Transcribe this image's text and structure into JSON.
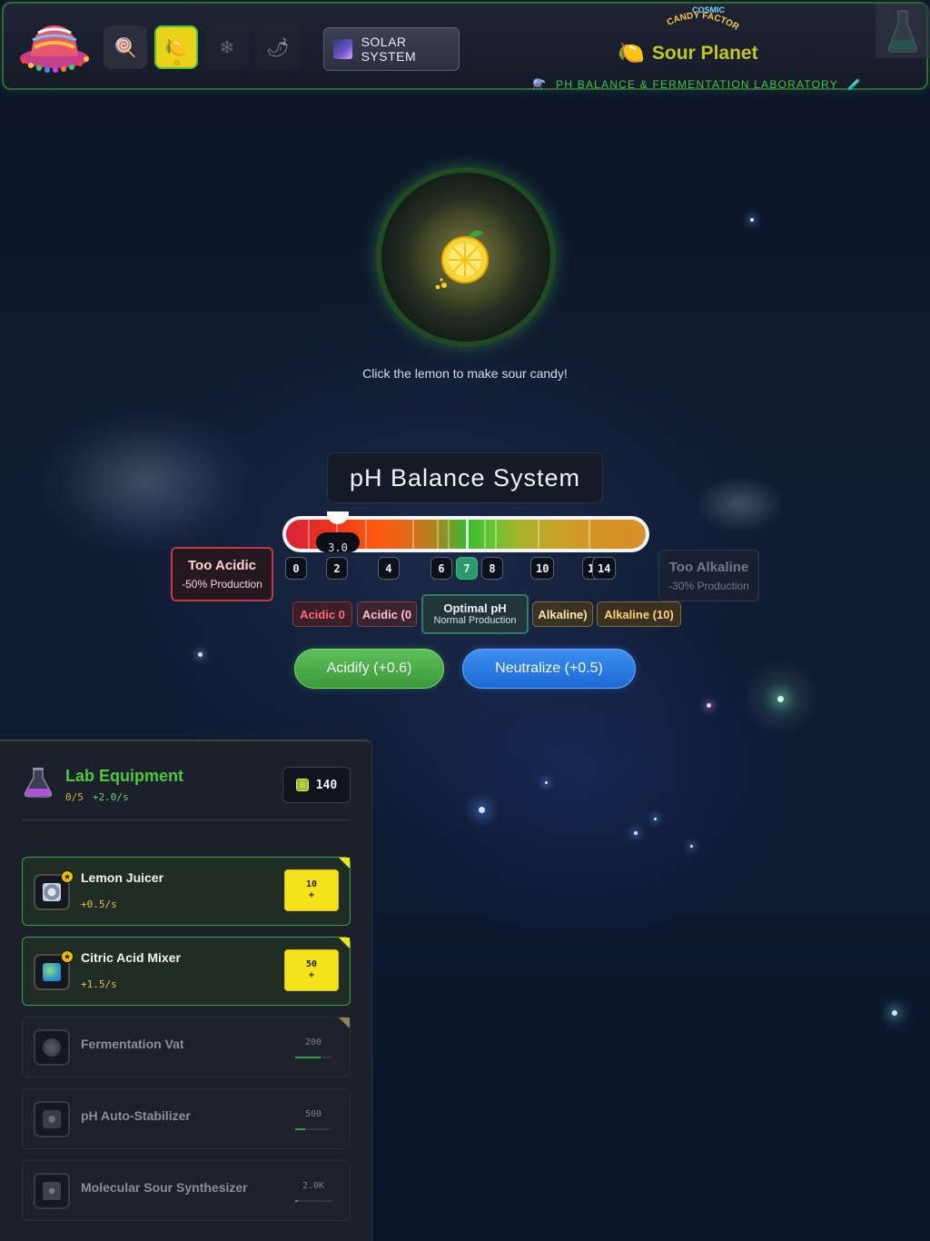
{
  "header": {
    "tool_buttons": [
      {
        "icon": "lollipop-icon",
        "glyph": "🍭",
        "active": false
      },
      {
        "icon": "lemon-icon",
        "glyph": "🍋",
        "active": true
      },
      {
        "icon": "snowflake-icon",
        "glyph": "❄",
        "active": false
      },
      {
        "icon": "chili-icon",
        "glyph": "🌶",
        "active": false
      }
    ],
    "solar_label": "SOLAR SYSTEM",
    "brand_line1": "COSMIC",
    "brand_line2": "CANDY FACTORY",
    "planet_name": "Sour Planet",
    "planet_icon": "🍋",
    "lab_subtitle": "PH BALANCE & FERMENTATION LABORATORY"
  },
  "lemon": {
    "hint": "Click the lemon to make sour candy!"
  },
  "ph": {
    "title": "pH Balance System",
    "current_value": "3.0",
    "current_level": 3.0,
    "scale_numbers": [
      "0",
      "2",
      "4",
      "6",
      "7",
      "8",
      "10",
      "12",
      "14"
    ],
    "acidic_box": {
      "title": "Too Acidic",
      "subtitle": "-50% Production"
    },
    "alkaline_box": {
      "title": "Too Alkaline",
      "subtitle": "-30% Production"
    },
    "zone_chips": {
      "acidic_1": "Acidic 0",
      "acidic_2": "Acidic (0",
      "optimal": "Optimal pH",
      "optimal_sub": "Normal Production",
      "alkaline_1": "Alkaline)",
      "alkaline_2": "Alkaline (10)"
    },
    "acidify_label": "Acidify (+0.6)",
    "neutralize_label": "Neutralize (+0.5)"
  },
  "lab": {
    "title": "Lab Equipment",
    "count": "0/5",
    "rate": "+2.0/s",
    "coins": "140",
    "items": [
      {
        "name": "Lemon Juicer",
        "rate": "+0.5/s",
        "price": "10",
        "price_suffix": "+",
        "state": "unlocked"
      },
      {
        "name": "Citric Acid Mixer",
        "rate": "+1.5/s",
        "price": "50",
        "price_suffix": "+",
        "state": "unlocked"
      },
      {
        "name": "Fermentation Vat",
        "cost": "200",
        "progress": 0.7,
        "state": "locked"
      },
      {
        "name": "pH Auto-Stabilizer",
        "cost": "500",
        "progress": 0.28,
        "state": "locked"
      },
      {
        "name": "Molecular Sour Synthesizer",
        "cost": "2.0K",
        "progress": 0.07,
        "state": "locked"
      }
    ]
  },
  "colors": {
    "accent_green": "#4ec842",
    "lemon_yellow": "#f5e31c",
    "acid_red": "#c23a45",
    "neutral_blue": "#1d6ad6"
  }
}
